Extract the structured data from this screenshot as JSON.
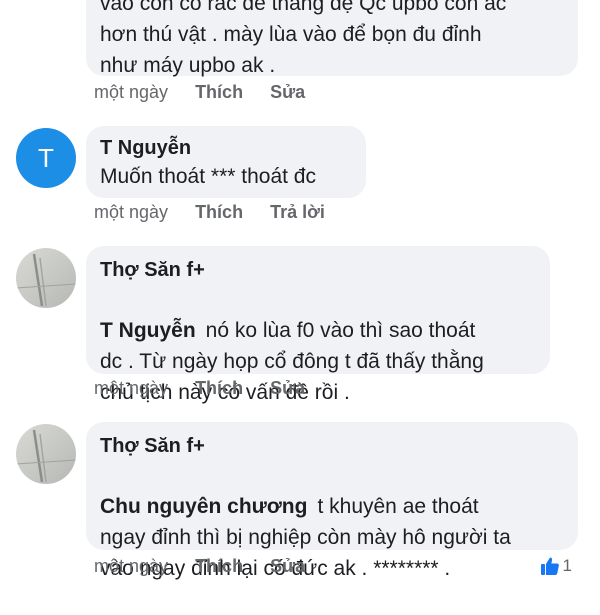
{
  "comments": [
    {
      "text": "vào con có rác để thắng dẹ Qc upbo con ác\nhơn thú vật . mày lùa vào để bọn đu đỉnh\nnhư máy upbo ak .",
      "time": "một ngày",
      "like_label": "Thích",
      "action_label": "Sửa"
    },
    {
      "avatar_letter": "T",
      "author": "T Nguyễn",
      "text": "Muốn thoát *** thoát đc",
      "time": "một ngày",
      "like_label": "Thích",
      "action_label": "Trả lời"
    },
    {
      "author": "Thợ Săn f+",
      "mention": "T Nguyễn",
      "text_first": "nó ko lùa f0 vào thì sao thoát",
      "text_rest": "dc . Từ ngày họp cổ đông t đã thấy thằng\nchủ tịch này có vấn đề rồi .",
      "time": "một ngày",
      "like_label": "Thích",
      "action_label": "Sửa"
    },
    {
      "author": "Thợ Săn f+",
      "mention": "Chu nguyên chương",
      "text_first": "t khuyên ae thoát",
      "text_rest": "ngay đỉnh thì bị nghiệp còn mày hô người ta\nvào ngay đỉnh lại có đức ak . ******** .",
      "time": "một ngày",
      "like_label": "Thích",
      "action_label": "Sửa",
      "reaction_count": "1"
    }
  ],
  "colors": {
    "bubble_bg": "#f0f2f5",
    "meta_text": "#65676b",
    "avatar_blue": "#1c8ee6",
    "like_blue": "#1877f2"
  }
}
